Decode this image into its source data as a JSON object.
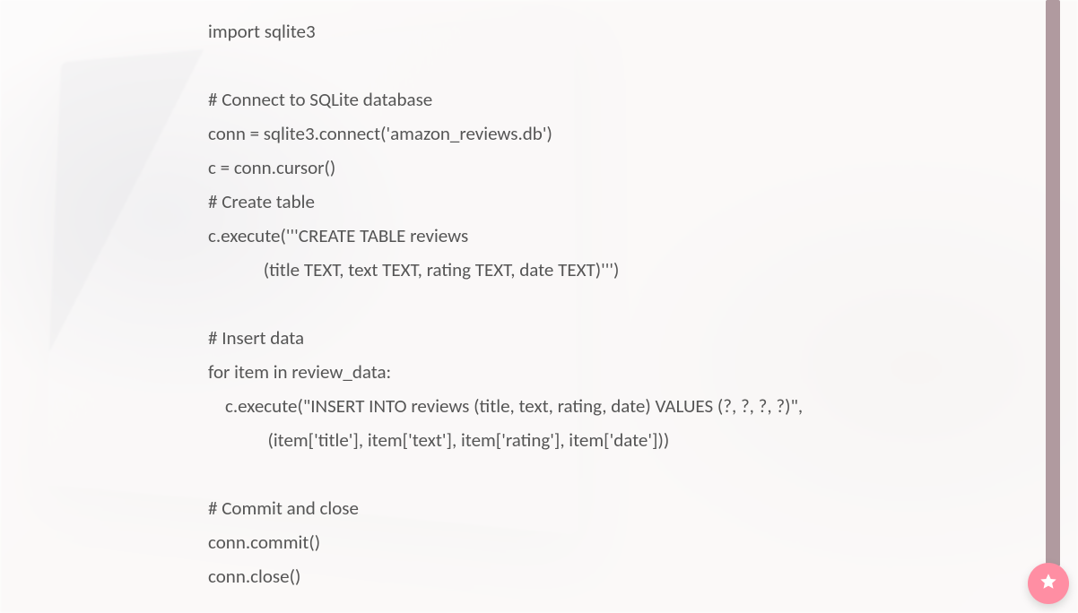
{
  "code": {
    "lines": [
      "import sqlite3",
      "",
      "# Connect to SQLite database",
      "conn = sqlite3.connect('amazon_reviews.db')",
      "c = conn.cursor()",
      "# Create table",
      "c.execute('''CREATE TABLE reviews",
      "             (title TEXT, text TEXT, rating TEXT, date TEXT)''')",
      "",
      "# Insert data",
      "for item in review_data:",
      "    c.execute(\"INSERT INTO reviews (title, text, rating, date) VALUES (?, ?, ?, ?)\",",
      "              (item['title'], item['text'], item['rating'], item['date']))",
      "",
      "# Commit and close",
      "conn.commit()",
      "conn.close()"
    ]
  },
  "fab": {
    "icon_name": "star-icon"
  },
  "colors": {
    "scrollbar_thumb": "#b09a9f",
    "fab_bg": "#ff8ea3",
    "code_text": "#555555"
  }
}
